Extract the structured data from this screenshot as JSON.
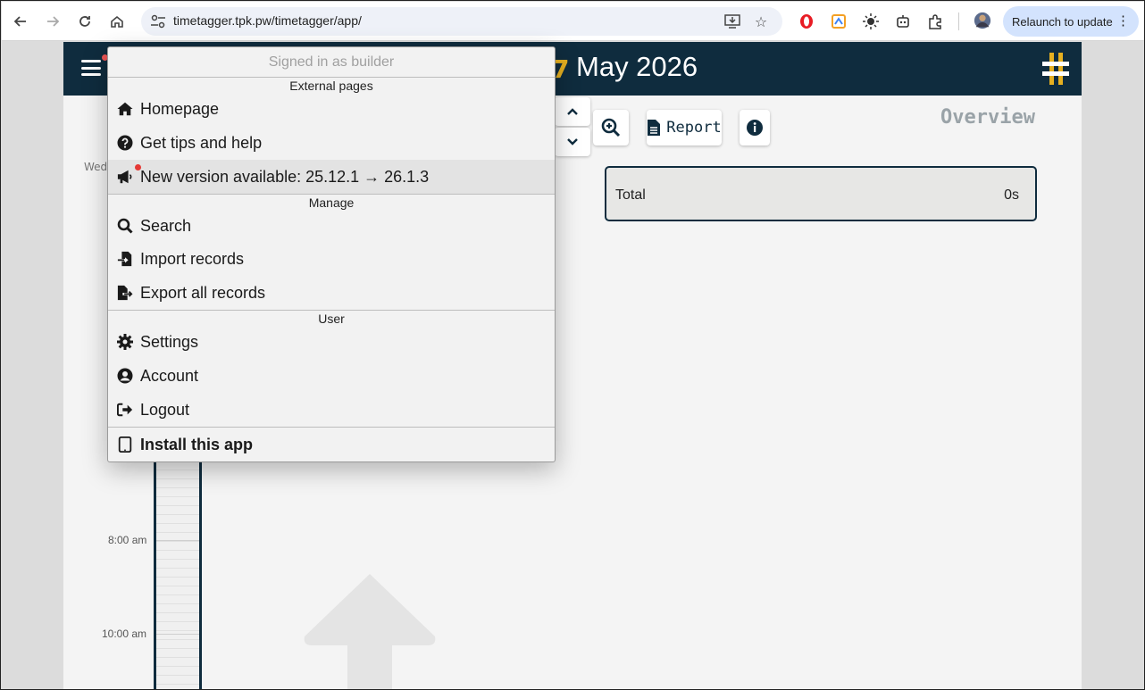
{
  "browser": {
    "url": "timetagger.tpk.pw/timetagger/app/",
    "relaunch_label": "Relaunch to update"
  },
  "app": {
    "header_title": "May 2026",
    "header_mark": "7",
    "report_label": "Report",
    "overview_label": "Overview",
    "total_label": "Total",
    "total_value": "0s",
    "day_label": "Wed",
    "time_labels": [
      "8:00 am",
      "10:00 am"
    ]
  },
  "menu": {
    "signed_in": "Signed in as builder",
    "sections": {
      "external": "External pages",
      "manage": "Manage",
      "user": "User"
    },
    "items": {
      "homepage": "Homepage",
      "tips": "Get tips and help",
      "new_version": "New version available: 25.12.1 → 26.1.3",
      "search": "Search",
      "import": "Import records",
      "export": "Export all records",
      "settings": "Settings",
      "account": "Account",
      "logout": "Logout",
      "install": "Install this app"
    }
  },
  "colors": {
    "header_bg": "#0f2c3e",
    "accent_yellow": "#e6b020",
    "notification_red": "#e53935"
  }
}
